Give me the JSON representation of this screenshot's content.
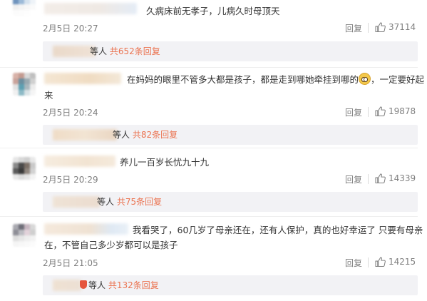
{
  "comments": [
    {
      "text": "久病床前无孝子，儿病久时母顶天",
      "time": "2月5日 20:27",
      "reply_label": "回复",
      "likes": "37114",
      "sub_tail_prefix": "等人 ",
      "sub_link": "共652条回复"
    },
    {
      "text": "在妈妈的眼里不管多大都是孩子，都是走到哪她牵挂到哪的",
      "text_suffix": "，一定要好起",
      "text_line2": "来",
      "time": "2月5日 20:24",
      "reply_label": "回复",
      "likes": "19878",
      "sub_tail_prefix": "等人 ",
      "sub_link": "共82条回复"
    },
    {
      "text": "养儿一百岁长忧九十九",
      "time": "2月5日 20:29",
      "reply_label": "回复",
      "likes": "14339",
      "sub_tail_prefix": "等人 ",
      "sub_link": "共75条回复"
    },
    {
      "text": "我看哭了，60几岁了母亲还在，还有人保护，真的也好幸运了 只要有母亲",
      "text_line2": "在，不管自己多少岁都可以是孩子",
      "time": "2月5日 21:05",
      "reply_label": "回复",
      "likes": "14215",
      "sub_tail_prefix": "等人 ",
      "sub_link": "共132条回复"
    }
  ],
  "colors": {
    "link": "#eb7350",
    "meta": "#808080",
    "sub_bg": "#f2f2f5"
  },
  "icons": {
    "like": "thumbs-up-icon",
    "emoji": "worried-face-emoji"
  }
}
